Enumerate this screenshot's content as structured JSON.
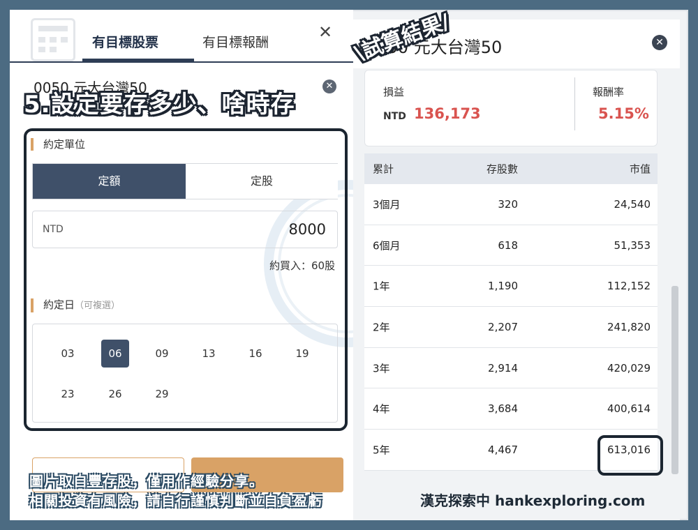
{
  "left_panel": {
    "tabs": [
      "有目標股票",
      "有目標報酬"
    ],
    "subtitle": "0050 元大台灣50",
    "caption": "5.設定要存多少、啥時存",
    "unit_label": "約定單位",
    "unit_options": [
      "定額",
      "定股"
    ],
    "amount_currency": "NTD",
    "amount_value": "8000",
    "buy_note": "約買入：60股",
    "day_label": "約定日",
    "day_label_note": "（可複選）",
    "days": [
      "03",
      "06",
      "09",
      "13",
      "16",
      "19",
      "23",
      "26",
      "29"
    ],
    "selected_day": "06"
  },
  "right_panel": {
    "title": "0050 元大台灣50",
    "stamp": "\\試算結果/",
    "profit_label": "損益",
    "profit_currency": "NTD",
    "profit_value": "136,173",
    "return_label": "報酬率",
    "return_value": "5.15%",
    "table": {
      "headers": [
        "累計",
        "存股數",
        "市值"
      ],
      "rows": [
        [
          "3個月",
          "320",
          "24,540"
        ],
        [
          "6個月",
          "618",
          "51,353"
        ],
        [
          "1年",
          "1,190",
          "112,152"
        ],
        [
          "2年",
          "2,207",
          "241,820"
        ],
        [
          "3年",
          "2,914",
          "420,029"
        ],
        [
          "4年",
          "3,684",
          "400,614"
        ],
        [
          "5年",
          "4,467",
          "613,016"
        ]
      ]
    }
  },
  "footer": {
    "line1": "圖片取自豐存股，僅用作經驗分享。",
    "line2": "相關投資有風險，請自行謹慎判斷並自負盈虧",
    "brand": "漢克探索中 hankexploring.com"
  },
  "colors": {
    "accent_navy": "#3f5069",
    "accent_gold": "#d9a266",
    "profit_red": "#d9534f",
    "border_blue": "#4c6b82"
  }
}
